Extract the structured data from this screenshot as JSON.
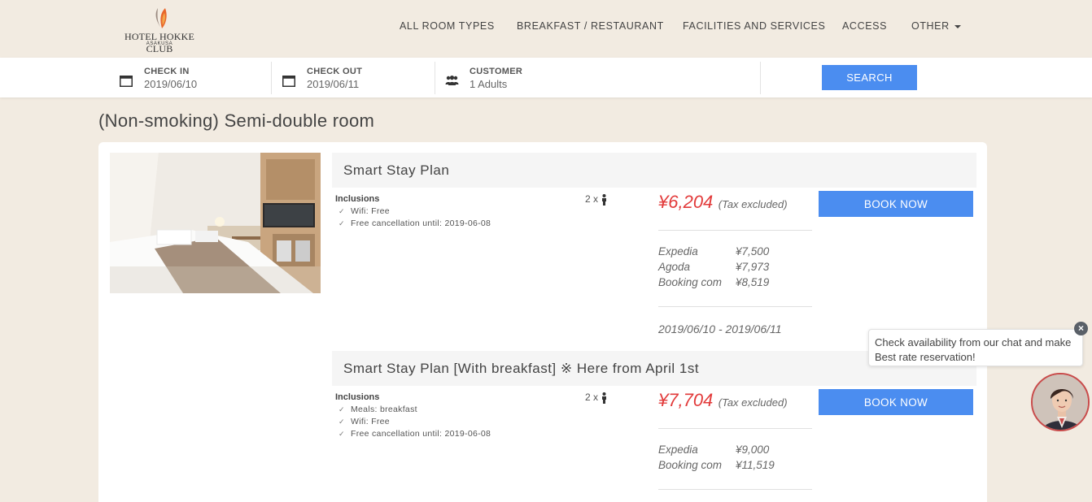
{
  "logo": {
    "name": "HOTEL HOKKE CLUB",
    "sub": "ASAKUSA"
  },
  "nav": [
    "ALL ROOM TYPES",
    "BREAKFAST / RESTAURANT",
    "FACILITIES AND SERVICES",
    "ACCESS",
    "OTHER"
  ],
  "search": {
    "checkin_label": "CHECK IN",
    "checkin_value": "2019/06/10",
    "checkout_label": "CHECK OUT",
    "checkout_value": "2019/06/11",
    "customer_label": "CUSTOMER",
    "customer_value": "1 Adults",
    "button": "SEARCH"
  },
  "room_title": "(Non-smoking) Semi-double room",
  "plans": [
    {
      "title": "Smart Stay Plan",
      "inclusions_label": "Inclusions",
      "inclusions": [
        "Wifi: Free",
        "Free cancellation until: 2019-06-08"
      ],
      "occupancy": "2 x",
      "price": "¥6,204",
      "tax": "(Tax excluded)",
      "book": "BOOK NOW",
      "ota": [
        {
          "name": "Expedia",
          "price": "¥7,500"
        },
        {
          "name": "Agoda",
          "price": "¥7,973"
        },
        {
          "name": "Booking com",
          "price": "¥8,519"
        }
      ],
      "dates": "2019/06/10 - 2019/06/11"
    },
    {
      "title": "Smart Stay Plan [With breakfast] ※ Here from April 1st",
      "inclusions_label": "Inclusions",
      "inclusions": [
        "Meals: breakfast",
        "Wifi: Free",
        "Free cancellation until: 2019-06-08"
      ],
      "occupancy": "2 x",
      "price": "¥7,704",
      "tax": "(Tax excluded)",
      "book": "BOOK NOW",
      "ota": [
        {
          "name": "Expedia",
          "price": "¥9,000"
        },
        {
          "name": "Booking com",
          "price": "¥11,519"
        }
      ]
    }
  ],
  "chat": {
    "message": "Check availability from our chat and make Best rate reservation!"
  },
  "colors": {
    "accent": "#4b8df0",
    "price": "#e23a3a",
    "background": "#f2ebe1",
    "logo_flame": "#e8662a"
  },
  "icons": [
    "calendar-icon",
    "group-icon",
    "person-icon",
    "close-icon",
    "caret-down-icon"
  ]
}
